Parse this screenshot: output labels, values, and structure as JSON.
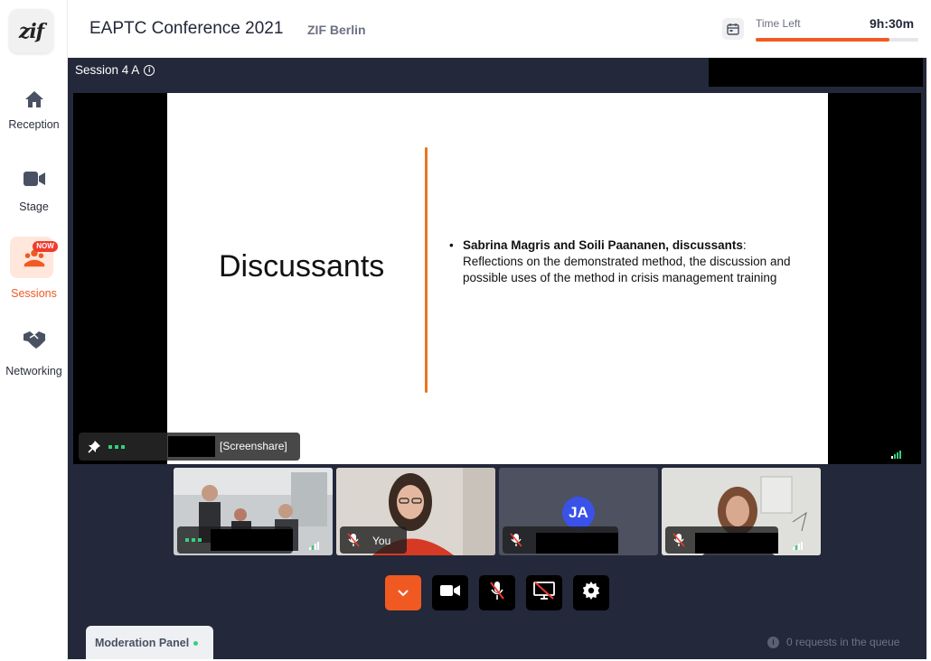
{
  "sidebar": {
    "logo_text": "zif",
    "items": [
      {
        "label": "Reception",
        "icon": "home-icon"
      },
      {
        "label": "Stage",
        "icon": "video-camera-icon"
      },
      {
        "label": "Sessions",
        "icon": "sessions-group-icon",
        "badge": "NOW",
        "active": true
      },
      {
        "label": "Networking",
        "icon": "handshake-icon"
      }
    ]
  },
  "header": {
    "title": "EAPTC Conference 2021",
    "org": "ZIF Berlin",
    "time_left_label": "Time Left",
    "time_left_value": "9h:30m",
    "time_progress": 0.82
  },
  "session": {
    "title": "Session 4 A"
  },
  "slide": {
    "heading": "Discussants",
    "bullet_bold": "Sabrina Magris and Soili Paananen, discussants",
    "bullet_text": ": Reflections on the demonstrated method, the discussion and possible uses of the method in crisis management training"
  },
  "screenshare": {
    "label": "[Screenshare]"
  },
  "participants": [
    {
      "type": "video",
      "label": ""
    },
    {
      "type": "video",
      "label": "You"
    },
    {
      "type": "avatar",
      "initials": "JA"
    },
    {
      "type": "video",
      "label": ""
    }
  ],
  "controls": [
    "chevron-down-icon",
    "camera-icon",
    "mic-off-icon",
    "screen-share-off-icon",
    "settings-icon"
  ],
  "moderation": {
    "tab_label": "Moderation Panel",
    "queue_text": "0 requests in the queue"
  },
  "colors": {
    "accent": "#f05a22",
    "stage_bg": "#23283a",
    "status_green": "#33d17a",
    "avatar_blue": "#3a52e8"
  }
}
